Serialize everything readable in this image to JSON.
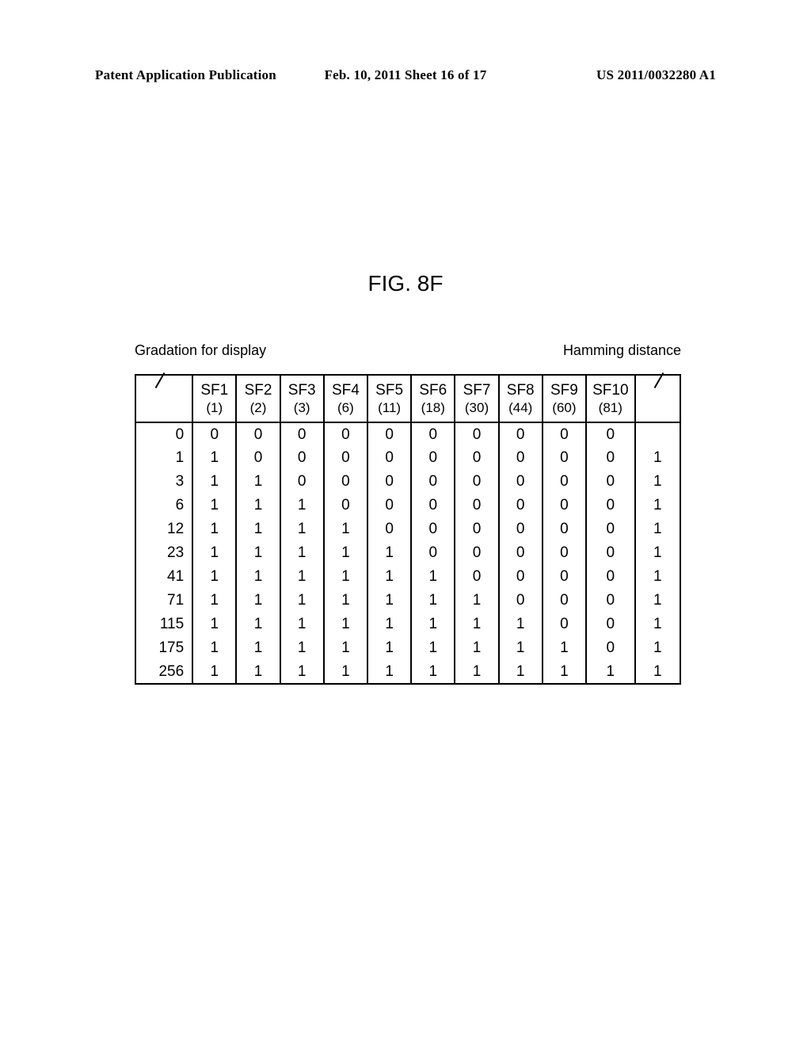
{
  "header": {
    "left": "Patent Application Publication",
    "center": "Feb. 10, 2011  Sheet 16 of 17",
    "right": "US 2011/0032280 A1"
  },
  "figure_title": "FIG. 8F",
  "labels": {
    "left": "Gradation for display",
    "right": "Hamming distance"
  },
  "chart_data": {
    "type": "table",
    "title": "FIG. 8F",
    "columns": [
      {
        "name": "SF1",
        "weight": 1
      },
      {
        "name": "SF2",
        "weight": 2
      },
      {
        "name": "SF3",
        "weight": 3
      },
      {
        "name": "SF4",
        "weight": 6
      },
      {
        "name": "SF5",
        "weight": 11
      },
      {
        "name": "SF6",
        "weight": 18
      },
      {
        "name": "SF7",
        "weight": 30
      },
      {
        "name": "SF8",
        "weight": 44
      },
      {
        "name": "SF9",
        "weight": 60
      },
      {
        "name": "SF10",
        "weight": 81
      }
    ],
    "rows": [
      {
        "gradation": 0,
        "sf": [
          0,
          0,
          0,
          0,
          0,
          0,
          0,
          0,
          0,
          0
        ],
        "hamming": ""
      },
      {
        "gradation": 1,
        "sf": [
          1,
          0,
          0,
          0,
          0,
          0,
          0,
          0,
          0,
          0
        ],
        "hamming": 1
      },
      {
        "gradation": 3,
        "sf": [
          1,
          1,
          0,
          0,
          0,
          0,
          0,
          0,
          0,
          0
        ],
        "hamming": 1
      },
      {
        "gradation": 6,
        "sf": [
          1,
          1,
          1,
          0,
          0,
          0,
          0,
          0,
          0,
          0
        ],
        "hamming": 1
      },
      {
        "gradation": 12,
        "sf": [
          1,
          1,
          1,
          1,
          0,
          0,
          0,
          0,
          0,
          0
        ],
        "hamming": 1
      },
      {
        "gradation": 23,
        "sf": [
          1,
          1,
          1,
          1,
          1,
          0,
          0,
          0,
          0,
          0
        ],
        "hamming": 1
      },
      {
        "gradation": 41,
        "sf": [
          1,
          1,
          1,
          1,
          1,
          1,
          0,
          0,
          0,
          0
        ],
        "hamming": 1
      },
      {
        "gradation": 71,
        "sf": [
          1,
          1,
          1,
          1,
          1,
          1,
          1,
          0,
          0,
          0
        ],
        "hamming": 1
      },
      {
        "gradation": 115,
        "sf": [
          1,
          1,
          1,
          1,
          1,
          1,
          1,
          1,
          0,
          0
        ],
        "hamming": 1
      },
      {
        "gradation": 175,
        "sf": [
          1,
          1,
          1,
          1,
          1,
          1,
          1,
          1,
          1,
          0
        ],
        "hamming": 1
      },
      {
        "gradation": 256,
        "sf": [
          1,
          1,
          1,
          1,
          1,
          1,
          1,
          1,
          1,
          1
        ],
        "hamming": 1
      }
    ]
  }
}
